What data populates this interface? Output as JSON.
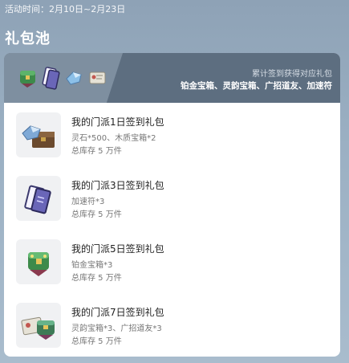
{
  "activity": {
    "time_text": "活动时间：2月10日~2月23日"
  },
  "section": {
    "title": "礼包池"
  },
  "pool": {
    "hint": "累计签到获得对应礼包",
    "rewards": "铂金宝箱、灵韵宝箱、广招道友、加速符",
    "header_icons": [
      "green-chest-icon",
      "speed-talisman-icon",
      "spirit-stone-icon",
      "scroll-icon"
    ]
  },
  "packs": [
    {
      "name": "我的门派1日签到礼包",
      "content": "灵石*500、木质宝箱*2",
      "stock": "总库存 5 万件",
      "icon": "spirit-stone-wood-chest-icon"
    },
    {
      "name": "我的门派3日签到礼包",
      "content": "加速符*3",
      "stock": "总库存 5 万件",
      "icon": "speed-talisman-icon"
    },
    {
      "name": "我的门派5日签到礼包",
      "content": "铂金宝箱*3",
      "stock": "总库存 5 万件",
      "icon": "platinum-chest-icon"
    },
    {
      "name": "我的门派7日签到礼包",
      "content": "灵韵宝箱*3、广招道友*3",
      "stock": "总库存 5 万件",
      "icon": "spirit-chest-scroll-icon"
    }
  ],
  "colors": {
    "background": "#9bb0c3",
    "header_dark": "#5d6e80",
    "header_light": "#7e8fa0",
    "thumb_bg": "#f0f1f3"
  }
}
